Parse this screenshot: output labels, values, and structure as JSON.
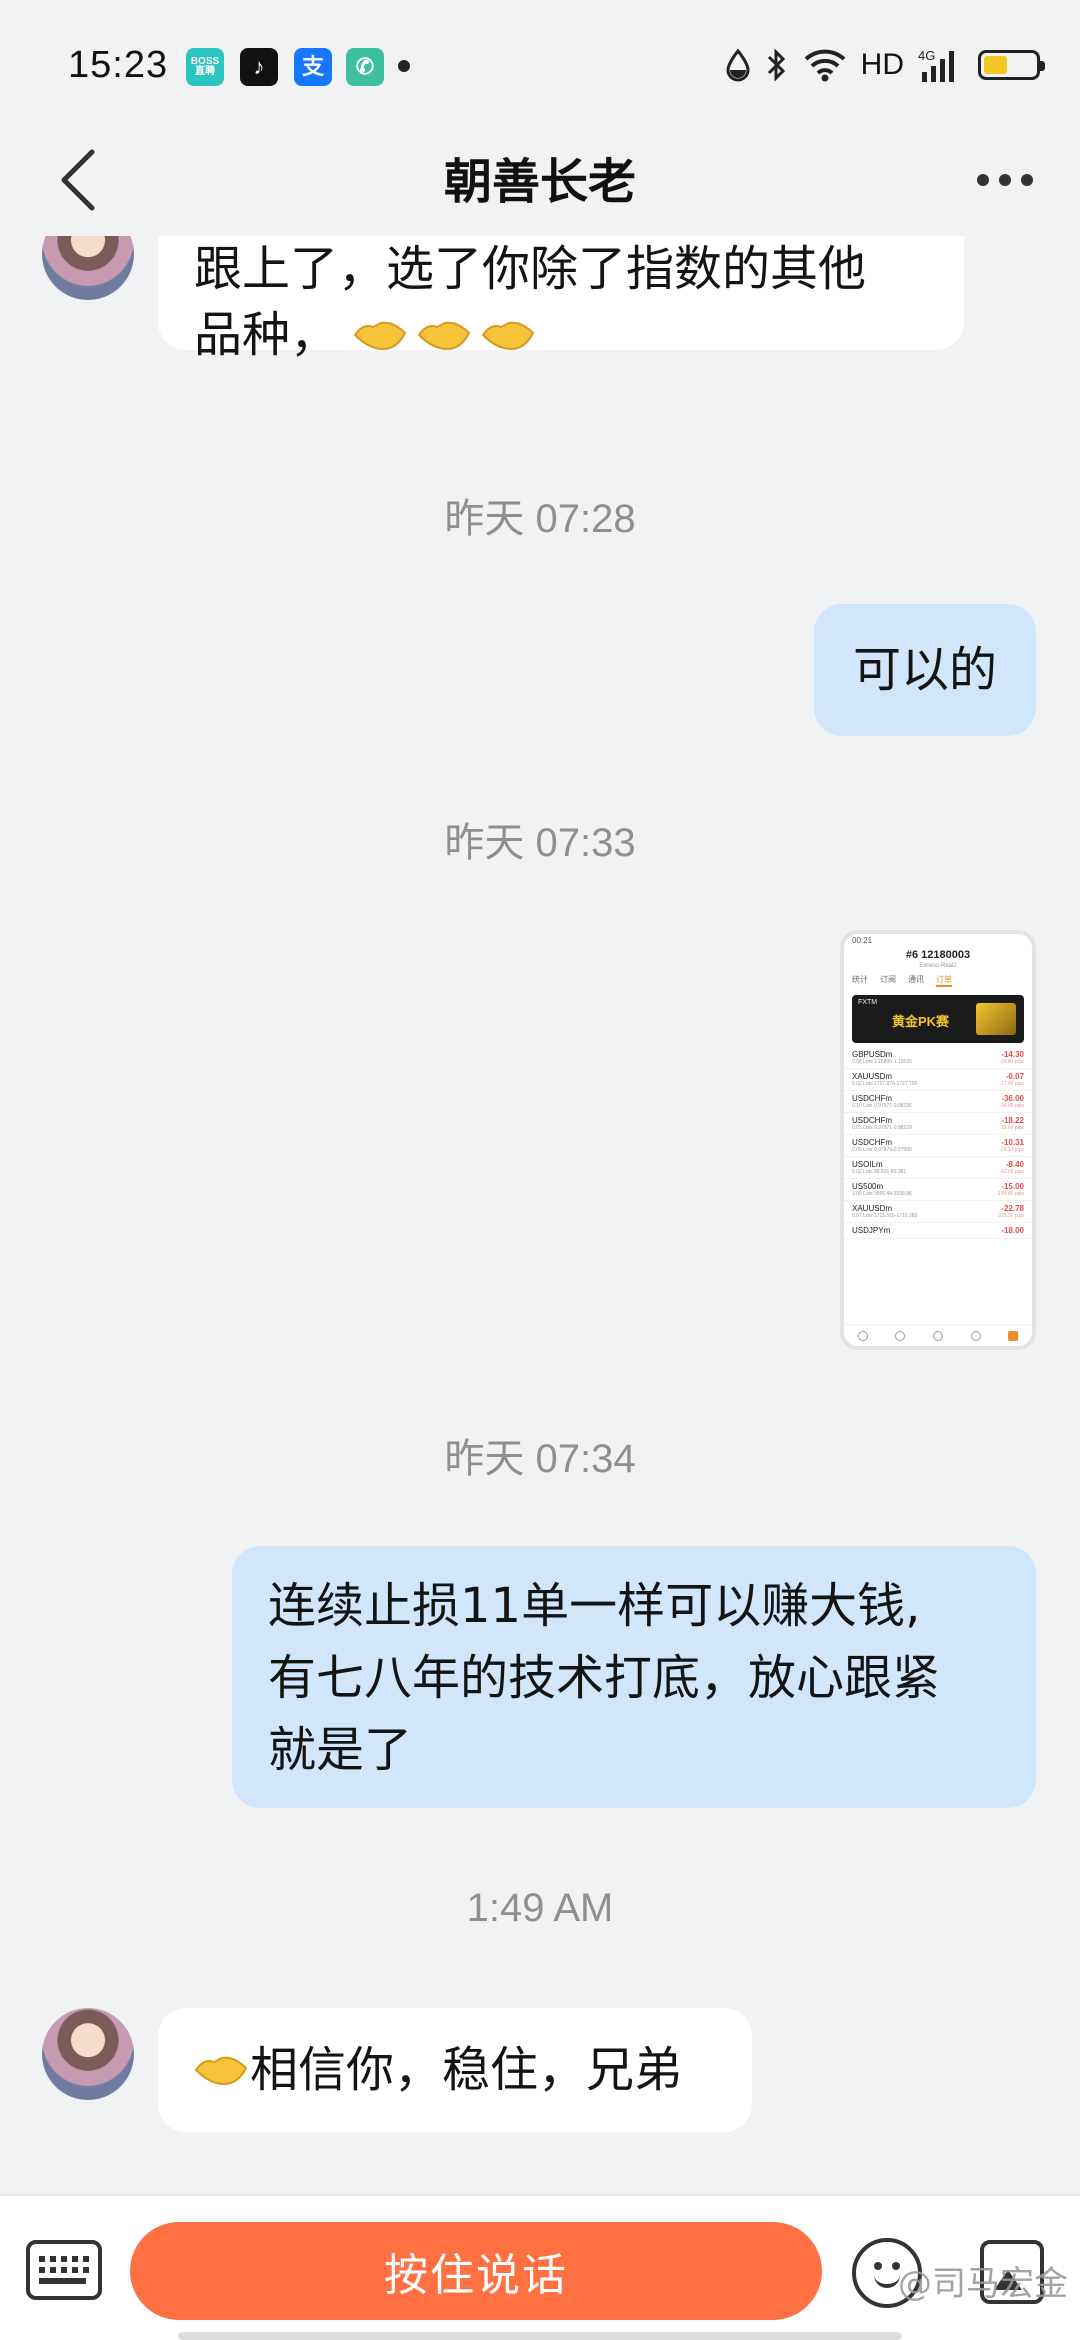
{
  "status_bar": {
    "time": "15:23",
    "apps": [
      {
        "name": "boss-app-icon",
        "label": "BOSS\n直聘",
        "color": "#2bc4c0"
      },
      {
        "name": "douyin-app-icon",
        "label": "♪",
        "color": "#111111"
      },
      {
        "name": "alipay-app-icon",
        "label": "支",
        "color": "#1677ff"
      },
      {
        "name": "phone-app-icon",
        "label": "✆",
        "color": "#3cc0a0"
      }
    ],
    "network": "HD",
    "signal": "4G",
    "battery_level": 0.45
  },
  "header": {
    "title": "朝善长老"
  },
  "messages": {
    "m1": {
      "text": "跟上了，选了你除了指数的其他",
      "text2": "品种，"
    },
    "ts1": "昨天 07:28",
    "m2": {
      "text": "可以的"
    },
    "ts2": "昨天 07:33",
    "ts3": "昨天 07:34",
    "m4": {
      "line1": "连续止损11单一样可以赚大钱,",
      "line2": "有七八年的技术打底，放心跟紧",
      "line3": "就是了"
    },
    "ts4": "1:49 AM",
    "m5": {
      "text": "相信你，稳住，兄弟"
    }
  },
  "screenshot_thumb": {
    "time": "00:21",
    "account": "#6  12180003",
    "server": "Exness-Real2",
    "tabs": [
      "统计",
      "订阅",
      "通讯",
      "订单"
    ],
    "banner_brand": "FXTM",
    "banner_title": "黄金PK赛",
    "rows": [
      {
        "symbol": "GBPUSDm",
        "detail": "0.06 Lots 1.15808-1.15630",
        "value": "-14.30",
        "pips": "-35.80 pips"
      },
      {
        "symbol": "XAUUSDm",
        "detail": "0.02 Lots 1727.879-1727.705",
        "value": "-0.07",
        "pips": "-17.40 pips"
      },
      {
        "symbol": "USDCHFm",
        "detail": "0.10 Lots 0.97877-0.98236",
        "value": "-36.00",
        "pips": "-34.90 pips"
      },
      {
        "symbol": "USDCHFm",
        "detail": "0.05 Lots 0.97871-0.98229",
        "value": "-18.22",
        "pips": "-35.80 pips"
      },
      {
        "symbol": "USDCHFm",
        "detail": "0.05 Lots 0.97879-0.97990",
        "value": "-10.31",
        "pips": "-18.10 pips"
      },
      {
        "symbol": "USOILm",
        "detail": "0.02 Lots 88.831-89.361",
        "value": "-8.40",
        "pips": "-42.00 pips"
      },
      {
        "symbol": "US500m",
        "detail": "1.00 Lots 3956.44-3938.86",
        "value": "-15.00",
        "pips": "-154.80 pips"
      },
      {
        "symbol": "XAUUSDm",
        "detail": "0.07 Lots 1715.565-1716.283",
        "value": "-22.78",
        "pips": "-328.30 pips"
      },
      {
        "symbol": "USDJPYm",
        "detail": "",
        "value": "-18.00",
        "pips": ""
      }
    ]
  },
  "bottom_bar": {
    "voice_label": "按住说话",
    "watermark": "@司马宏金"
  }
}
